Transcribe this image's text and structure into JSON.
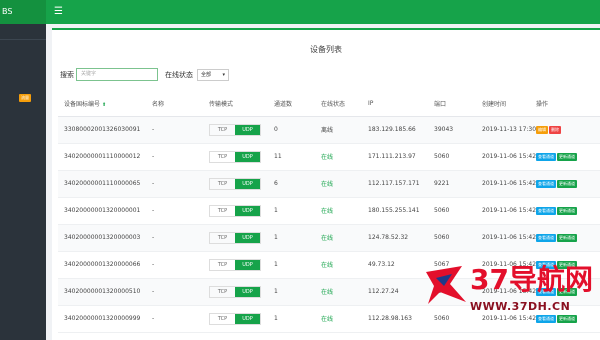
{
  "app": {
    "brand": "BS",
    "menu_icon": "hamburger-icon",
    "accent_color": "#16a34a"
  },
  "sidebar": {
    "badge": "流量"
  },
  "page": {
    "title": "设备列表"
  },
  "filter": {
    "search_label": "搜索",
    "search_placeholder": "关键字",
    "status_label": "在线状态",
    "status_value": "全部"
  },
  "table": {
    "headers": [
      "设备国标编号",
      "名称",
      "传输模式",
      "通道数",
      "在线状态",
      "IP",
      "端口",
      "创建时间",
      "操作"
    ],
    "rows": [
      {
        "id": "33080002001326030091",
        "name": "-",
        "tcp": "TCP",
        "udp": "UDP",
        "channels": "0",
        "status": "离线",
        "ip": "183.129.185.66",
        "port": "39043",
        "created": "2019-11-13 17:30",
        "btn1": "编辑",
        "btn2": "删除"
      },
      {
        "id": "34020000001110000012",
        "name": "-",
        "tcp": "TCP",
        "udp": "UDP",
        "channels": "11",
        "status": "在线",
        "ip": "171.111.213.97",
        "port": "5060",
        "created": "2019-11-06 15:42",
        "btn1": "查看通道",
        "btn2": "更新通道"
      },
      {
        "id": "34020000001110000065",
        "name": "-",
        "tcp": "TCP",
        "udp": "UDP",
        "channels": "6",
        "status": "在线",
        "ip": "112.117.157.171",
        "port": "9221",
        "created": "2019-11-06 15:42",
        "btn1": "查看通道",
        "btn2": "更新通道"
      },
      {
        "id": "34020000001320000001",
        "name": "-",
        "tcp": "TCP",
        "udp": "UDP",
        "channels": "1",
        "status": "在线",
        "ip": "180.155.255.141",
        "port": "5060",
        "created": "2019-11-06 15:42",
        "btn1": "查看通道",
        "btn2": "更新通道"
      },
      {
        "id": "34020000001320000003",
        "name": "-",
        "tcp": "TCP",
        "udp": "UDP",
        "channels": "1",
        "status": "在线",
        "ip": "124.78.52.32",
        "port": "5060",
        "created": "2019-11-06 15:42",
        "btn1": "查看通道",
        "btn2": "更新通道"
      },
      {
        "id": "34020000001320000066",
        "name": "-",
        "tcp": "TCP",
        "udp": "UDP",
        "channels": "1",
        "status": "在线",
        "ip": "49.73.12",
        "port": "5067",
        "created": "2019-11-06 15:42",
        "btn1": "查看通道",
        "btn2": "更新通道"
      },
      {
        "id": "34020000001320000510",
        "name": "-",
        "tcp": "TCP",
        "udp": "UDP",
        "channels": "1",
        "status": "在线",
        "ip": "112.27.24",
        "port": "5060",
        "created": "2019-11-06 15:42",
        "btn1": "查看通道",
        "btn2": "更新通道"
      },
      {
        "id": "34020000001320000999",
        "name": "-",
        "tcp": "TCP",
        "udp": "UDP",
        "channels": "1",
        "status": "在线",
        "ip": "112.28.98.163",
        "port": "5060",
        "created": "2019-11-06 15:42",
        "btn1": "查看通道",
        "btn2": "更新通道"
      }
    ]
  },
  "watermark": {
    "big": "37导航网",
    "url": "WWW.37DH.CN"
  }
}
